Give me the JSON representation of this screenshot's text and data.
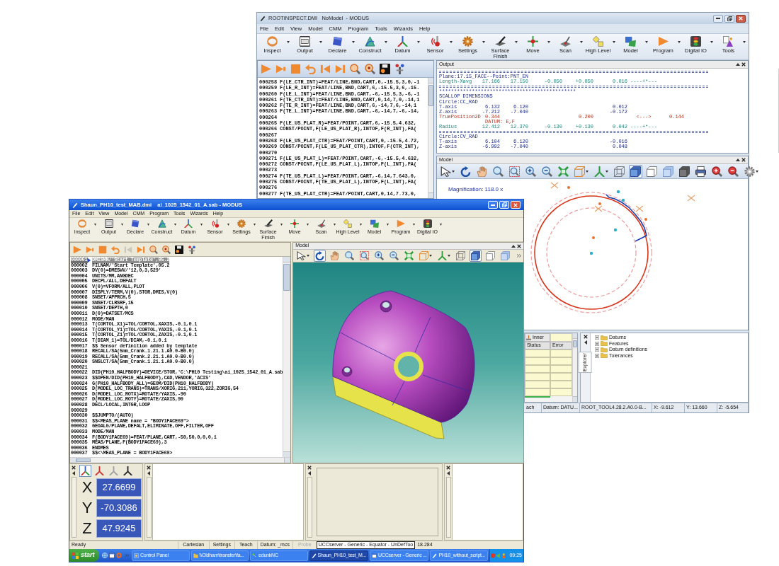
{
  "back_window": {
    "active": false,
    "title": "ROOTINSPECT.DMI   NoModel  - MODUS",
    "menu": [
      "File",
      "Edit",
      "View",
      "Model",
      "CMM",
      "Program",
      "Tools",
      "Wizards",
      "Help"
    ],
    "toolbar": [
      "Inspect",
      "Output",
      "Declare",
      "Construct",
      "Datum",
      "Sensor",
      "Settings",
      "Surface Finish",
      "Move",
      "Scan",
      "High Level",
      "Model",
      "Program",
      "Digital IO",
      "Tools"
    ],
    "program_controls": [
      {
        "disabled": false
      },
      {
        "disabled": false
      },
      {
        "disabled": false
      },
      {
        "disabled": false
      },
      {
        "disabled": false
      },
      {
        "disabled": false
      },
      {
        "disabled": false
      },
      {
        "disabled": false
      },
      {
        "disabled": false
      },
      {
        "disabled": false
      }
    ],
    "code_lines": [
      {
        "number": "000258",
        "text": "F(LE_CTR_INT)=FEAT/LINE,BND,CART,0,-15.5,3,0,-1"
      },
      {
        "number": "000259",
        "text": "F(LE_R_INT)=FEAT/LINE,BND,CART,6,-15.5,3,6,-15."
      },
      {
        "number": "000260",
        "text": "F(LE_L_INT)=FEAT/LINE,BND,CART,-6,-15.5,3,-6,-1"
      },
      {
        "number": "000261",
        "text": "F(TE_CTR_INT)=FEAT/LINE,BND,CART,0,14,7,0,-14,1"
      },
      {
        "number": "000262",
        "text": "F(TE_R_INT)=FEAT/LINE,BND,CART,6,-14,7,6,-14,1"
      },
      {
        "number": "000263",
        "text": "F(TE_L_INT)=FEAT/LINE,BND,CART,-6,-14,7,-6,-14,"
      },
      {
        "number": "000264"
      },
      {
        "number": "000265",
        "text": "F(LE_US_PLAT_R)=FEAT/POINT,CART,6,-15.5,4.632,"
      },
      {
        "number": "000266",
        "text": "CONST/POINT,F(LE_US_PLAT_R),INTOF,F(R_INT),FA("
      },
      {
        "number": "000267"
      },
      {
        "number": "000268",
        "text": "F(LE_US_PLAT_CTR)=FEAT/POINT,CART,0,-15.5,4.72,"
      },
      {
        "number": "000269",
        "text": "CONST/POINT,F(LE_US_PLAT_CTR),INTOF,F(CTR_INT),"
      },
      {
        "number": "000270"
      },
      {
        "number": "000271",
        "text": "F(LE_US_PLAT_L)=FEAT/POINT,CART,-6,-15.5,4.632,"
      },
      {
        "number": "000272",
        "text": "CONST/POINT,F(LE_US_PLAT_L),INTOF,F(L_INT),FA("
      },
      {
        "number": "000273"
      },
      {
        "number": "000274",
        "text": "F(TE_US_PLAT_L)=FEAT/POINT,CART,-6,14,7.643,0,"
      },
      {
        "number": "000275",
        "text": "CONST/POINT,F(TE_US_PLAT_L),INTOF,F(L_INT),FA("
      },
      {
        "number": "000276"
      },
      {
        "number": "000277",
        "text": "F(TE_US_PLAT_CTR)=FEAT/POINT,CART,0,14,7.73,0,"
      }
    ],
    "output_panel": {
      "title": "Output",
      "lines": [
        {
          "kind": "rule"
        },
        {
          "kind": "plain",
          "label": "Plane:17.15_FACE--Point:PNT_EN"
        },
        {
          "kind": "pass",
          "label": "Length-Xavg",
          "actual": "17.166",
          "nominal": "17.150",
          "lower": "-0.050",
          "upper": "+0.050",
          "deviation": "0.016",
          "graph": "----+*---"
        },
        {
          "kind": "rule"
        },
        {
          "kind": "plain",
          "label": "**********************************************"
        },
        {
          "kind": "plain",
          "label": "SCALLOP DIMENSIONS"
        },
        {
          "kind": "plain",
          "label": "Circle:CC_RAD"
        },
        {
          "kind": "plain",
          "label": "T-axis",
          "actual": "6.132",
          "nominal": "6.120",
          "deviation": "0.012"
        },
        {
          "kind": "plain",
          "label": "Z-axis",
          "actual": "-7.212",
          "nominal": "-7.040",
          "deviation": "-0.172"
        },
        {
          "kind": "fail",
          "label": "TruePosition2D",
          "actual": "0.344",
          "upper": "0.200",
          "graph": "<--->",
          "excess": "0.144"
        },
        {
          "kind": "fail",
          "note": "DATUM: E,F"
        },
        {
          "kind": "pass",
          "label": "Radius",
          "actual": "12.412",
          "nominal": "12.370",
          "lower": "-0.130",
          "upper": "+0.130",
          "deviation": "0.042",
          "graph": "----+*---"
        },
        {
          "kind": "rule"
        },
        {
          "kind": "plain",
          "label": "Circle:CV_RAD"
        },
        {
          "kind": "plain",
          "label": "T-axis",
          "actual": "6.104",
          "nominal": "6.120",
          "deviation": "-0.016"
        },
        {
          "kind": "plain",
          "label": "Z-axis",
          "actual": "-6.992",
          "nominal": "-7.040",
          "deviation": "0.048"
        }
      ]
    },
    "model_panel": {
      "title": "Model",
      "tools": [
        {
          "selected": false
        },
        {
          "selected": false
        },
        {
          "selected": false
        },
        {
          "selected": false
        },
        {
          "selected": false
        },
        {
          "selected": false
        },
        {
          "selected": false
        },
        {
          "selected": false
        },
        {
          "selected": false
        },
        {
          "selected": false
        },
        {
          "selected": false
        },
        {
          "selected": true
        },
        {
          "selected": false
        },
        {
          "selected": false
        },
        {
          "selected": false
        },
        {
          "selected": false
        },
        {
          "selected": false
        },
        {
          "selected": false
        },
        {
          "selected": false
        }
      ],
      "magnification": "Magnification: 118.0 x"
    },
    "results_table": {
      "header": "Inner",
      "columns": [
        "Status",
        "Error"
      ]
    },
    "explorer": {
      "tab": "Explorer",
      "items": [
        {
          "label": "Datums",
          "expanded": false
        },
        {
          "label": "Features",
          "expanded": false
        },
        {
          "label": "Datum definitions",
          "expanded": false
        },
        {
          "label": "Tolerances",
          "expanded": false
        }
      ]
    },
    "status_bar": [
      "ach",
      "Datum: DATU...",
      "ROOT_TOOL4.28.2.A0.0-B...",
      "X: -9.612",
      "Y: 13.660",
      "Z: -5.654"
    ]
  },
  "front_window": {
    "active": true,
    "title": "Shaun_PH10_test_MAB.dmi    ai_1025_1542_01_A.sab - MODUS",
    "menu": [
      "File",
      "Edit",
      "View",
      "Model",
      "CMM",
      "Program",
      "Tools",
      "Wizards",
      "Help"
    ],
    "toolbar": [
      "Inspect",
      "Output",
      "Declare",
      "Construct",
      "Datum",
      "Sensor",
      "Settings",
      "Surface Finish",
      "Move",
      "Scan",
      "High Level",
      "Model",
      "Program",
      "Digital IO"
    ],
    "program_controls": [
      {
        "disabled": false
      },
      {
        "disabled": false
      },
      {
        "disabled": false
      },
      {
        "disabled": false
      },
      {
        "disabled": true
      },
      {
        "disabled": false
      },
      {
        "disabled": false
      },
      {
        "disabled": false
      },
      {
        "disabled": false
      },
      {
        "disabled": false
      }
    ],
    "code_lines": [
      {
        "number": "000001",
        "text": "DMISMN/'Start Template',05.2",
        "selected": true
      },
      {
        "number": "000002",
        "text": "FILNAM/'Start Template',05.2",
        "selected": false
      },
      {
        "number": "000003",
        "text": "DV(0)=DMESWV/'12,0,3,529'",
        "selected": false
      },
      {
        "number": "000004",
        "text": "UNITS/MM,ANGDEC",
        "selected": false
      },
      {
        "number": "000005",
        "text": "DECPL/ALL,DEFALT",
        "selected": false
      },
      {
        "number": "000006",
        "text": "V(0)=VFORM/ALL,PLOT",
        "selected": false
      },
      {
        "number": "000007",
        "text": "DISPLY/TERM,V(0),STOR,DMIS,V(0)",
        "selected": false
      },
      {
        "number": "000008",
        "text": "SNSET/APPRCH,5",
        "selected": false
      },
      {
        "number": "000009",
        "text": "SNSET/CLRSRF,15",
        "selected": false
      },
      {
        "number": "000010",
        "text": "SNSET/DEPTH,0",
        "selected": false
      },
      {
        "number": "000011",
        "text": "D(0)=DATSET/MCS",
        "selected": false
      },
      {
        "number": "000012",
        "text": "MODE/MAN",
        "selected": false
      },
      {
        "number": "000013",
        "text": "T(CORTOL_X1)=TOL/CORTOL,XAXIS,-0.1,0.1",
        "selected": false
      },
      {
        "number": "000014",
        "text": "T(CORTOL_Y1)=TOL/CORTOL,YAXIS,-0.1,0.1",
        "selected": false
      },
      {
        "number": "000015",
        "text": "T(CORTOL_Z1)=TOL/CORTOL,ZAXIS,-0.1,0.1",
        "selected": false
      },
      {
        "number": "000016",
        "text": "T(DIAM_1)=TOL/DIAM,-0.1,0.1",
        "selected": false
      },
      {
        "number": "000017",
        "text": "$$ Sensor definition added by template",
        "selected": false
      },
      {
        "number": "000018",
        "text": "RECALL/SA(5mm_Crank.1.21.1.A0.0-B0.0)",
        "selected": false
      },
      {
        "number": "000019",
        "text": "RECALL/SA(5mm_Crank.2.21.1.A0.0-B0.0)",
        "selected": false
      },
      {
        "number": "000020",
        "text": "SNSLCT/SA(5mm_Crank.1.21.1.A0.0-B0.0)",
        "selected": false
      },
      {
        "number": "000021",
        "selected": false
      },
      {
        "number": "000022",
        "text": "DID(PH10_HALFBODY)=DEVICE/STOR,'C:\\PH10 Testing\\ai_1025_1542_01_A.sab",
        "selected": false
      },
      {
        "number": "000023",
        "text": "$$OPEN/DID(PH10_HALFBODY),CAD,VENDOR,'ACIS'",
        "selected": false
      },
      {
        "number": "000024",
        "text": "G(PH10_HALFBODY_ALL)=GEOM/DID(PH10_HALFBODY)",
        "selected": false
      },
      {
        "number": "000025",
        "text": "D(MODEL_LOC_TRANS)=TRANS/XORIG,211,YORIG,322,ZORIG,54",
        "selected": false
      },
      {
        "number": "000026",
        "text": "D(MODEL_LOC_ROTX)=ROTATE/YAXIS,-90",
        "selected": false
      },
      {
        "number": "000027",
        "text": "D(MODEL_LOC_ROTY)=ROTATE/ZAXIS,90",
        "selected": false
      },
      {
        "number": "000028",
        "text": "DECL/LOCAL,INTGR,LOOP",
        "selected": false
      },
      {
        "number": "000029",
        "selected": false
      },
      {
        "number": "000030",
        "text": "$$JUMPTO/(AUTO)",
        "selected": false
      },
      {
        "number": "000031",
        "text": "$$<MEAS_PLANE name = \"BODY1FACE69\">",
        "selected": false
      },
      {
        "number": "000032",
        "text": "GEOALG/PLANE,DEFALT,ELIMINATE,OFF,FILTER,OFF",
        "selected": false
      },
      {
        "number": "000033",
        "text": "MODE/MAN",
        "selected": false
      },
      {
        "number": "000034",
        "text": "F(BODY1FACE69)=FEAT/PLANE,CART,-50,50,0,0,0,1",
        "selected": false
      },
      {
        "number": "000035",
        "text": "MEAS/PLANE,F(BODY1FACE69),3",
        "selected": false
      },
      {
        "number": "000036",
        "text": "ENDMES",
        "selected": false
      },
      {
        "number": "000037",
        "text": "$$<\\MEAS_PLANE = BODY1FACE69>",
        "selected": false
      }
    ],
    "model_panel": {
      "title": "Model",
      "tools": [
        {
          "selected": false
        },
        {
          "selected": true
        },
        {
          "selected": false
        },
        {
          "selected": false
        },
        {
          "selected": false
        },
        {
          "selected": false
        },
        {
          "selected": false
        },
        {
          "selected": false
        },
        {
          "selected": false
        },
        {
          "selected": false
        },
        {
          "selected": false
        },
        {
          "selected": true
        },
        {
          "selected": false
        },
        {
          "selected": false
        }
      ]
    },
    "dro": {
      "axis_views": [
        {
          "selected": true
        },
        {
          "selected": false
        },
        {
          "selected": false
        },
        {
          "selected": false
        }
      ],
      "readings": [
        {
          "axis": "X",
          "value": "27.6699"
        },
        {
          "axis": "Y",
          "value": "-70.3086"
        },
        {
          "axis": "Z",
          "value": "47.9245"
        }
      ]
    },
    "status_bar": [
      {
        "text": "Ready",
        "disabled": false
      },
      {
        "text": "Cartesian",
        "disabled": false
      },
      {
        "text": "Settings",
        "disabled": false
      },
      {
        "text": "Teach",
        "disabled": false
      },
      {
        "text": "Datum: _mcs",
        "disabled": false
      },
      {
        "text": "Probe",
        "disabled": true
      }
    ],
    "tooltip": "UCCserver - Generic - Equator - UnDefToo",
    "status_value": "18.284"
  },
  "taskbar": {
    "start": "start",
    "tasks": [
      {
        "label": "Control Panel",
        "selected": false
      },
      {
        "label": "\\\\Oldham\\transfer\\fa...",
        "selected": false
      },
      {
        "label": "edunkNC",
        "selected": false
      },
      {
        "label": "Shaun_PH10_test_M...",
        "selected": true
      },
      {
        "label": "UCCserver - Generic ...",
        "selected": false
      },
      {
        "label": "PH10_without_script...",
        "selected": false
      }
    ],
    "clock": "09:25"
  }
}
